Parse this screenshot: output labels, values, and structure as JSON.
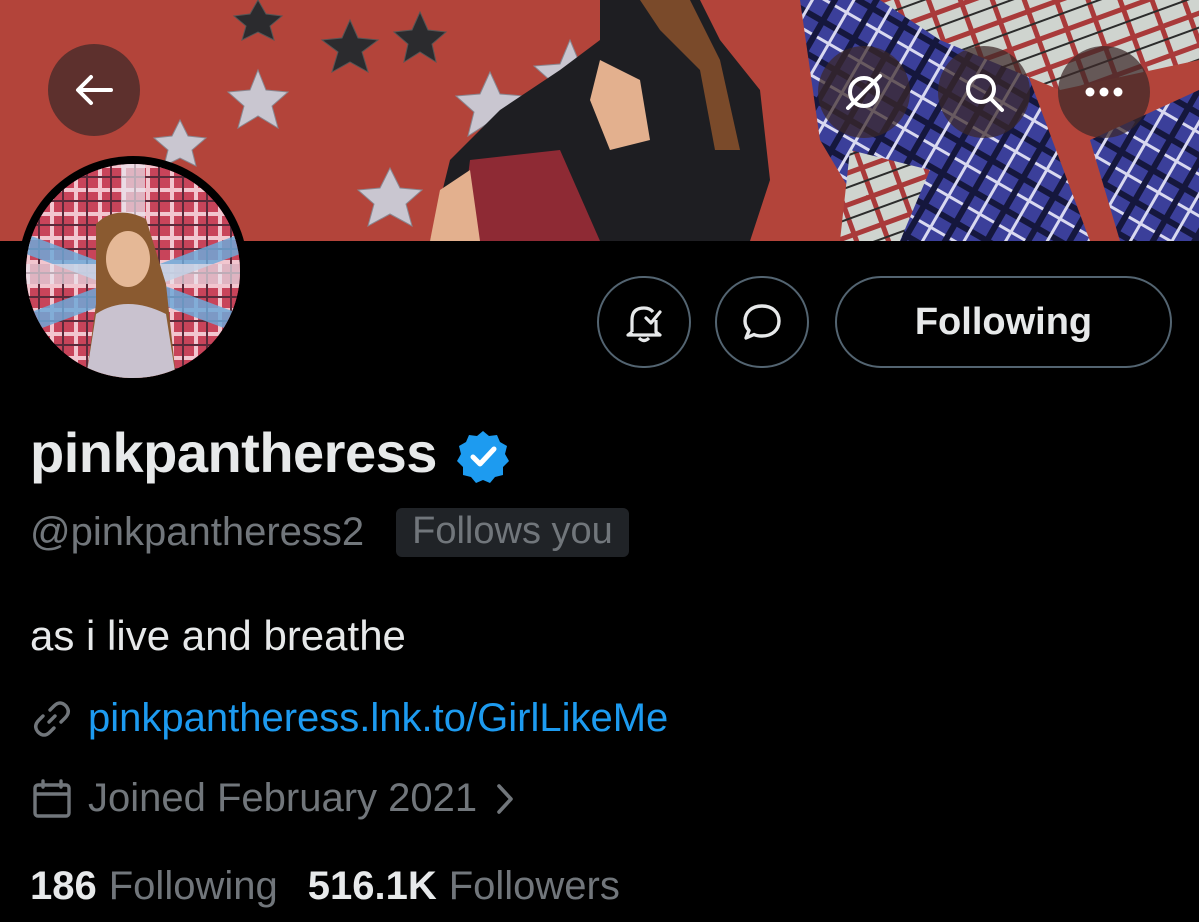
{
  "profile": {
    "display_name": "pinkpantheress",
    "handle": "@pinkpantheress2",
    "follows_you_badge": "Follows you",
    "bio": "as i live and breathe",
    "link": "pinkpantheress.lnk.to/GirlLikeMe",
    "joined": "Joined February 2021",
    "following_count": "186",
    "following_label": "Following",
    "followers_count": "516.1K",
    "followers_label": "Followers"
  },
  "actions": {
    "follow_button_label": "Following"
  },
  "icons": {
    "back": "arrow-left-icon",
    "grok": "grok-icon",
    "search": "search-icon",
    "more": "more-dots-icon",
    "notifications": "bell-check-icon",
    "message": "message-bubble-icon",
    "verified": "verified-badge-icon",
    "link": "link-icon",
    "calendar": "calendar-icon",
    "chevron": "chevron-right-icon"
  },
  "colors": {
    "background": "#000000",
    "accent_blue": "#1d9bf0",
    "muted_text": "#71767b",
    "primary_text": "#e7e9ea",
    "banner_red": "#b3443a"
  }
}
